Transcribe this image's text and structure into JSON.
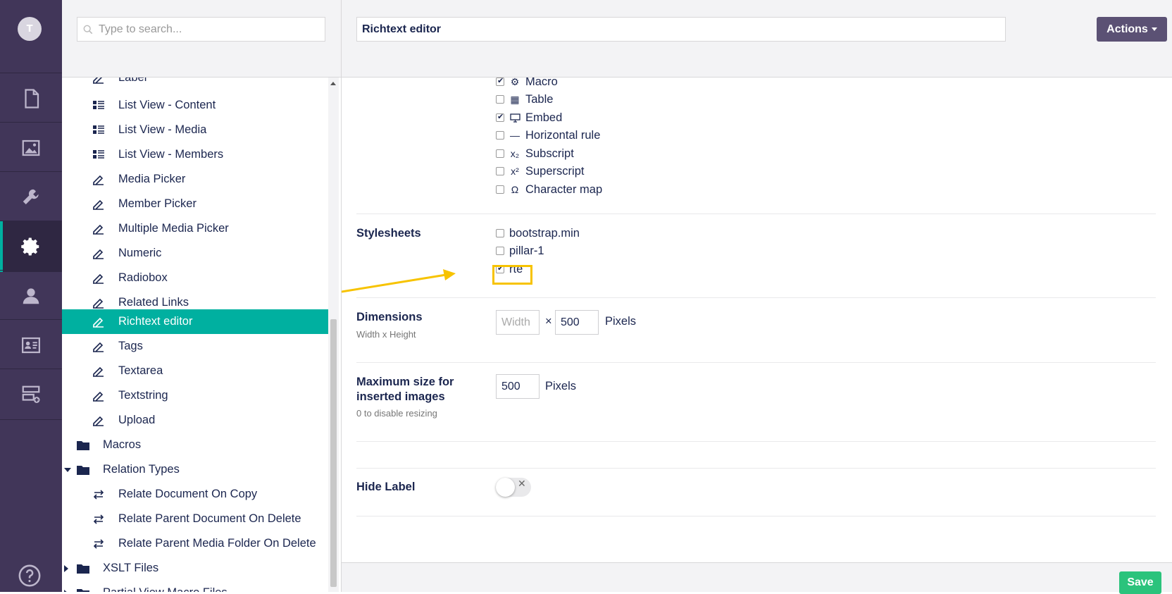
{
  "user": {
    "initial": "T"
  },
  "rail": {
    "sections": [
      "content-icon",
      "media-icon",
      "settings-wrench-icon",
      "developer-gear-icon",
      "users-icon",
      "members-icon",
      "forms-icon"
    ],
    "active": "developer-gear-icon"
  },
  "search": {
    "placeholder": "Type to search..."
  },
  "tree": {
    "items": [
      {
        "label": "Label",
        "icon": "edit-icon"
      },
      {
        "label": "List View - Content",
        "icon": "list-icon"
      },
      {
        "label": "List View - Media",
        "icon": "list-icon"
      },
      {
        "label": "List View - Members",
        "icon": "list-icon"
      },
      {
        "label": "Media Picker",
        "icon": "edit-icon"
      },
      {
        "label": "Member Picker",
        "icon": "edit-icon"
      },
      {
        "label": "Multiple Media Picker",
        "icon": "edit-icon"
      },
      {
        "label": "Numeric",
        "icon": "edit-icon"
      },
      {
        "label": "Radiobox",
        "icon": "edit-icon"
      },
      {
        "label": "Related Links",
        "icon": "edit-icon"
      },
      {
        "label": "Richtext editor",
        "icon": "edit-icon",
        "selected": true
      },
      {
        "label": "Tags",
        "icon": "edit-icon"
      },
      {
        "label": "Textarea",
        "icon": "edit-icon"
      },
      {
        "label": "Textstring",
        "icon": "edit-icon"
      },
      {
        "label": "Upload",
        "icon": "edit-icon"
      }
    ],
    "folders": [
      {
        "label": "Macros",
        "icon": "folder-icon"
      },
      {
        "label": "Relation Types",
        "icon": "folder-icon",
        "expanded": true
      },
      {
        "label": "XSLT Files",
        "icon": "folder-icon"
      },
      {
        "label": "Partial View Macro Files",
        "icon": "folder-icon"
      }
    ],
    "relation_items": [
      "Relate Document On Copy",
      "Relate Parent Document On Delete",
      "Relate Parent Media Folder On Delete"
    ]
  },
  "editor": {
    "name": "Richtext editor",
    "actions_label": "Actions",
    "toolbar_options": [
      {
        "label": "Macro",
        "icon": "cogs-icon",
        "checked": true
      },
      {
        "label": "Table",
        "icon": "table-icon",
        "checked": false
      },
      {
        "label": "Embed",
        "icon": "monitor-icon",
        "checked": true
      },
      {
        "label": "Horizontal rule",
        "icon": "hr-icon",
        "checked": false
      },
      {
        "label": "Subscript",
        "icon": "subscript-icon",
        "checked": false
      },
      {
        "label": "Superscript",
        "icon": "superscript-icon",
        "checked": false
      },
      {
        "label": "Character map",
        "icon": "omega-icon",
        "checked": false
      }
    ],
    "stylesheets": {
      "label": "Stylesheets",
      "items": [
        {
          "label": "bootstrap.min",
          "checked": false
        },
        {
          "label": "pillar-1",
          "checked": false
        },
        {
          "label": "rte",
          "checked": true
        }
      ]
    },
    "dimensions": {
      "label": "Dimensions",
      "description": "Width x Height",
      "width_placeholder": "Width",
      "width_value": "",
      "times": "×",
      "height_value": "500",
      "unit": "Pixels"
    },
    "max_image_size": {
      "label_line1": "Maximum size for",
      "label_line2": "inserted images",
      "description": "0 to disable resizing",
      "value": "500",
      "unit": "Pixels"
    },
    "hide_label": {
      "label": "Hide Label",
      "on": false
    },
    "save_label": "Save"
  },
  "colors": {
    "rail": "#413659",
    "accent": "#00b0a0",
    "highlight": "#f7c300",
    "save": "#2bc37c",
    "actions": "#5b5174"
  }
}
